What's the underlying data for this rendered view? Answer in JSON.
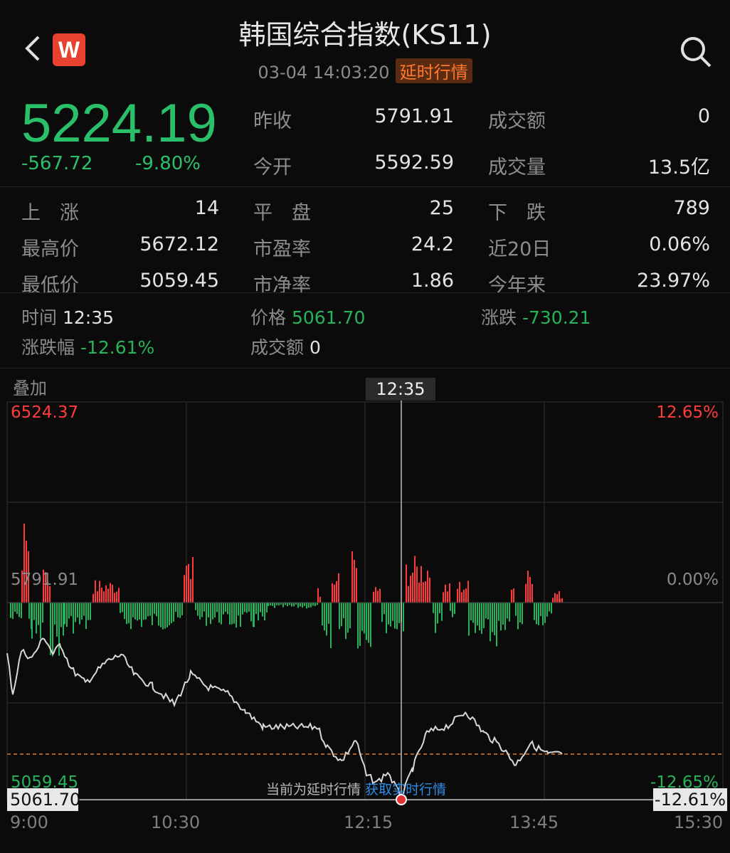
{
  "header": {
    "title": "韩国综合指数(KS11)",
    "datetime": "03-04 14:03:20",
    "badge": "延时行情",
    "logo_letter": "W"
  },
  "quote": {
    "price": "5224.19",
    "change": "-567.72",
    "change_pct": "-9.80%"
  },
  "stats": {
    "prev_close_label": "昨收",
    "prev_close": "5791.91",
    "open_label": "今开",
    "open": "5592.59",
    "turnover_label": "成交额",
    "turnover": "0",
    "volume_label": "成交量",
    "volume": "13.5亿",
    "up_label": "上　涨",
    "up": "14",
    "flat_label": "平　盘",
    "flat": "25",
    "down_label": "下　跌",
    "down": "789",
    "high_label": "最高价",
    "high": "5672.12",
    "pe_label": "市盈率",
    "pe": "24.2",
    "d20_label": "近20日",
    "d20": "0.06%",
    "low_label": "最低价",
    "low": "5059.45",
    "pb_label": "市净率",
    "pb": "1.86",
    "ytd_label": "今年来",
    "ytd": "23.97%"
  },
  "crosshair": {
    "time_label": "时间",
    "time": "12:35",
    "price_label": "价格",
    "price": "5061.70",
    "change_label": "涨跌",
    "change": "-730.21",
    "pct_label": "涨跌幅",
    "pct": "-12.61%",
    "turnover_label": "成交额",
    "turnover": "0"
  },
  "chart": {
    "overlay_label": "叠加",
    "cursor_time": "12:35",
    "y_max": "6524.37",
    "y_max_pct": "12.65%",
    "y_mid": "5791.91",
    "y_mid_pct": "0.00%",
    "y_min": "5059.45",
    "y_min_pct": "-12.65%",
    "cursor_price": "5061.70",
    "cursor_pct": "-12.61%",
    "x_labels": [
      "9:00",
      "10:30",
      "12:15",
      "13:45",
      "15:30"
    ],
    "notice_text": "当前为延时行情",
    "notice_link": "获取实时行情"
  },
  "colors": {
    "up": "#ff3b3b",
    "down": "#27b35a",
    "accent": "#ff7a2a"
  }
}
